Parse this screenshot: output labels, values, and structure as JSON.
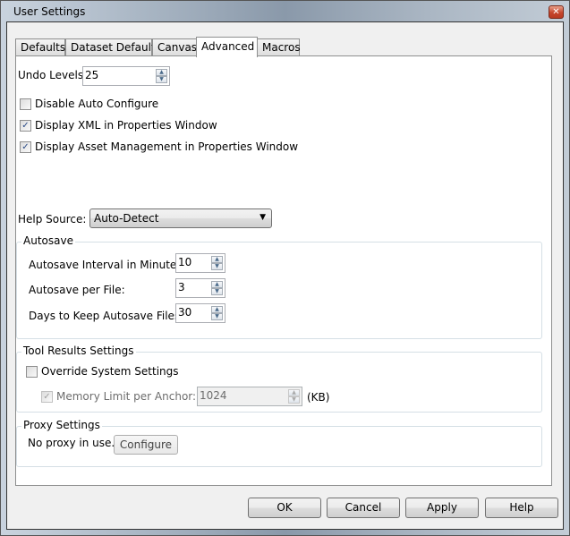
{
  "window": {
    "title": "User Settings",
    "close_icon": "close-x-icon"
  },
  "tabs": [
    {
      "label": "Defaults",
      "active": false
    },
    {
      "label": "Dataset Defaults",
      "active": false
    },
    {
      "label": "Canvas",
      "active": false
    },
    {
      "label": "Advanced",
      "active": true
    },
    {
      "label": "Macros",
      "active": false
    }
  ],
  "advanced": {
    "undo_levels": {
      "label": "Undo Levels:",
      "value": "25"
    },
    "checkboxes": [
      {
        "label": "Disable Auto Configure",
        "checked": false
      },
      {
        "label": "Display XML in Properties Window",
        "checked": true
      },
      {
        "label": "Display Asset Management in Properties Window",
        "checked": true
      }
    ],
    "help_source": {
      "label": "Help Source:",
      "value": "Auto-Detect"
    },
    "autosave": {
      "title": "Autosave",
      "fields": [
        {
          "label": "Autosave Interval in Minutes:",
          "value": "10"
        },
        {
          "label": "Autosave per File:",
          "value": "3"
        },
        {
          "label": "Days to Keep Autosave Files:",
          "value": "30"
        }
      ]
    },
    "tool_results": {
      "title": "Tool Results Settings",
      "override": {
        "label": "Override System Settings",
        "checked": false
      },
      "memory_limit": {
        "label": "Memory Limit per Anchor:",
        "checked": true,
        "disabled": true,
        "value": "1024",
        "unit": "(KB)"
      }
    },
    "proxy": {
      "title": "Proxy Settings",
      "status": "No proxy in use.",
      "configure_label": "Configure"
    }
  },
  "buttons": {
    "ok": "OK",
    "cancel": "Cancel",
    "apply": "Apply",
    "help": "Help"
  },
  "glyphs": {
    "check": "✓",
    "up": "▲",
    "down": "▼",
    "close": "✕"
  }
}
